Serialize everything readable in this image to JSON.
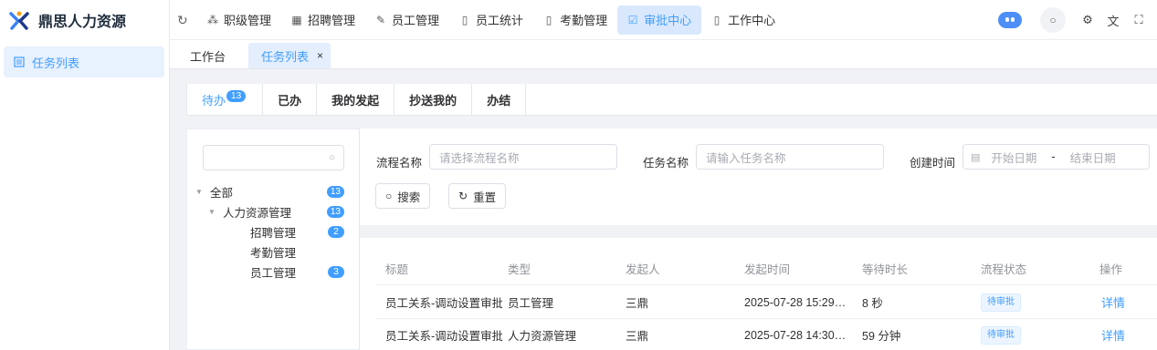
{
  "app": {
    "title": "鼎思人力资源"
  },
  "sidebar": {
    "items": [
      {
        "label": "任务列表",
        "icon": "list-icon"
      }
    ]
  },
  "topnav": {
    "items": [
      {
        "label": "职级管理",
        "icon": "hierarchy-icon"
      },
      {
        "label": "招聘管理",
        "icon": "grid-icon"
      },
      {
        "label": "员工管理",
        "icon": "edit-icon"
      },
      {
        "label": "员工统计",
        "icon": "document-icon"
      },
      {
        "label": "考勤管理",
        "icon": "document-icon"
      },
      {
        "label": "审批中心",
        "icon": "checkbox-icon",
        "active": true
      },
      {
        "label": "工作中心",
        "icon": "document-icon"
      }
    ]
  },
  "tabs": {
    "home": "工作台",
    "current": "任务列表"
  },
  "subtabs": [
    {
      "label": "待办",
      "badge": "13",
      "active": true
    },
    {
      "label": "已办"
    },
    {
      "label": "我的发起"
    },
    {
      "label": "抄送我的"
    },
    {
      "label": "办结"
    }
  ],
  "tree": {
    "nodes": [
      {
        "label": "全部",
        "count": "13"
      },
      {
        "label": "人力资源管理",
        "count": "13"
      },
      {
        "label": "招聘管理",
        "count": "2"
      },
      {
        "label": "考勤管理",
        "count": ""
      },
      {
        "label": "员工管理",
        "count": "3"
      }
    ]
  },
  "filters": {
    "process_label": "流程名称",
    "process_placeholder": "请选择流程名称",
    "task_label": "任务名称",
    "task_placeholder": "请输入任务名称",
    "created_label": "创建时间",
    "start_placeholder": "开始日期",
    "date_separator": "-",
    "end_placeholder": "结束日期",
    "search_button": "搜索",
    "reset_button": "重置"
  },
  "table": {
    "headers": [
      "标题",
      "类型",
      "发起人",
      "发起时间",
      "等待时长",
      "流程状态",
      "操作"
    ],
    "rows": [
      {
        "title": "员工关系-调动设置审批",
        "type": "员工管理",
        "initiator": "三鼎",
        "time": "2025-07-28 15:29…",
        "wait": "8 秒",
        "status": "待审批",
        "action": "详情"
      },
      {
        "title": "员工关系-调动设置审批",
        "type": "人力资源管理",
        "initiator": "三鼎",
        "time": "2025-07-28 14:30…",
        "wait": "59 分钟",
        "status": "待审批",
        "action": "详情"
      }
    ]
  },
  "colors": {
    "accent": "#409eff",
    "active_bg": "#d9e8fd"
  }
}
